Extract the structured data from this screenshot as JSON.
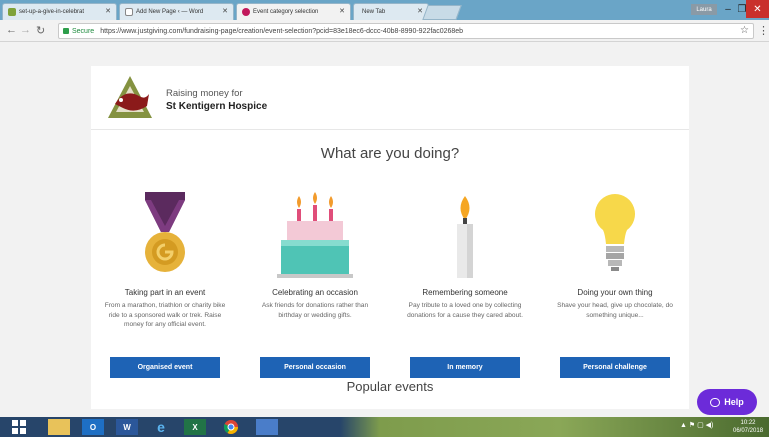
{
  "browser": {
    "tabs": [
      {
        "title": "set-up-a-give-in-celebrat",
        "fav_color": "#7fa23a"
      },
      {
        "title": "Add New Page ‹ — Word",
        "fav_color": "#888888"
      },
      {
        "title": "Event category selection",
        "fav_color": "#c2185b"
      },
      {
        "title": "New Tab",
        "fav_color": "#ffffff"
      }
    ],
    "user_badge": "Laura",
    "address": {
      "secure_label": "Secure",
      "url": "https://www.justgiving.com/fundraising-page/creation/event-selection?pcid=83e18ec6-dccc-40b8-8990-922fac0268eb"
    }
  },
  "page": {
    "raising_label": "Raising money for",
    "charity_name": "St Kentigern Hospice",
    "heading": "What are you doing?",
    "options": [
      {
        "title": "Taking part in an event",
        "description": "From a marathon, triathlon or charity bike ride to a sponsored walk or trek. Raise money for any official event.",
        "button": "Organised event",
        "icon": "medal-icon"
      },
      {
        "title": "Celebrating an occasion",
        "description": "Ask friends for donations rather than birthday or wedding gifts.",
        "button": "Personal occasion",
        "icon": "cake-icon"
      },
      {
        "title": "Remembering someone",
        "description": "Pay tribute to a loved one by collecting donations for a cause they cared about.",
        "button": "In memory",
        "icon": "candle-icon"
      },
      {
        "title": "Doing your own thing",
        "description": "Shave your head, give up chocolate, do something unique...",
        "button": "Personal challenge",
        "icon": "lightbulb-icon"
      }
    ],
    "popular_heading": "Popular events",
    "help_label": "Help"
  },
  "taskbar": {
    "clock_time": "10:22",
    "clock_date": "06/07/2018"
  },
  "colors": {
    "primary_button": "#1e63b5",
    "help_button": "#6c2bd9"
  }
}
